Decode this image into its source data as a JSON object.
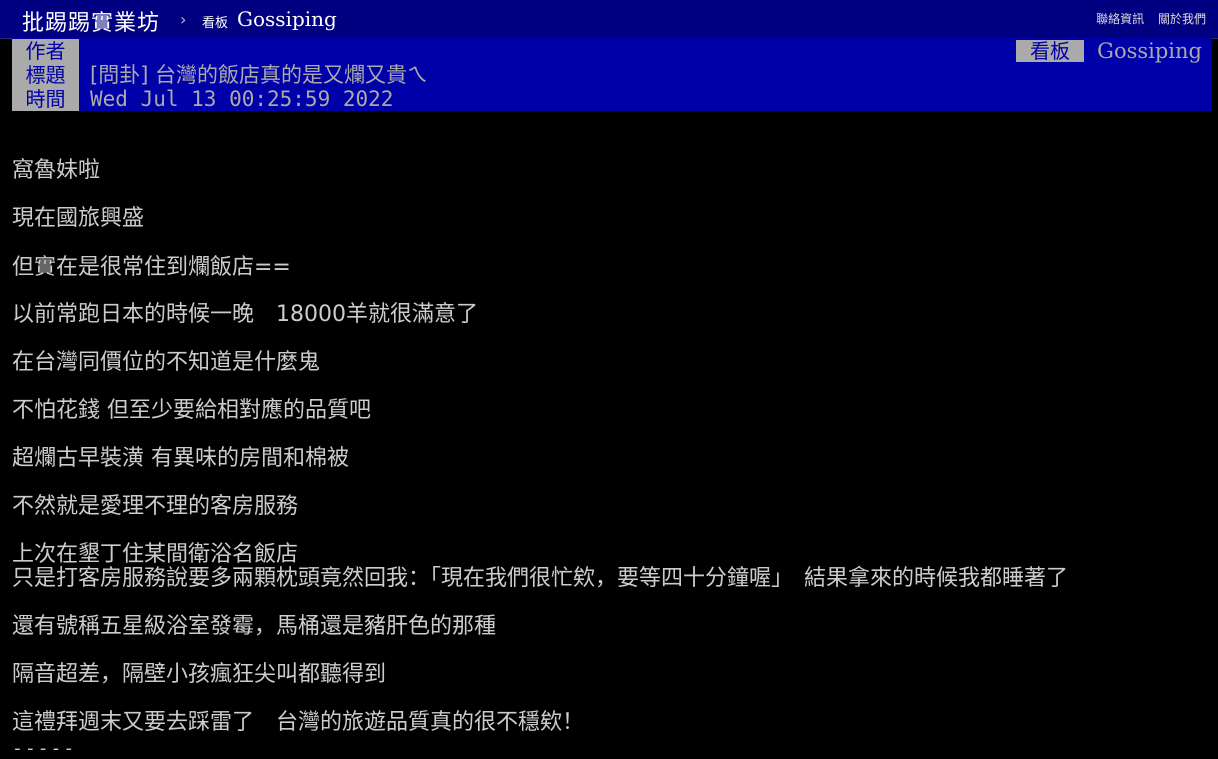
{
  "topbar": {
    "site_name": "批踢踢實業坊",
    "separator": "›",
    "board_prefix": "看板",
    "board_name": "Gossiping",
    "links": [
      "聯絡資訊",
      "關於我們"
    ]
  },
  "meta": {
    "author_label": "作者",
    "author_value": "",
    "title_label": "標題",
    "title_value": "[問卦] 台灣的飯店真的是又爛又貴ㄟ",
    "time_label": "時間",
    "time_value": "Wed Jul 13 00:25:59 2022",
    "board_label": "看板",
    "board_value": "Gossiping"
  },
  "content": {
    "lines": [
      "窩魯妹啦",
      "現在國旅興盛",
      "但實在是很常住到爛飯店==",
      "以前常跑日本的時候一晚　18000羊就很滿意了",
      "在台灣同價位的不知道是什麼鬼",
      "不怕花錢 但至少要給相對應的品質吧",
      "超爛古早裝潢 有異味的房間和棉被",
      "不然就是愛理不理的客房服務",
      "上次在墾丁住某間衛浴名飯店",
      "只是打客房服務說要多兩顆枕頭竟然回我：「現在我們很忙欸，要等四十分鐘喔」　結果拿來的時候我都睡著了",
      "還有號稱五星級浴室發霉，馬桶還是豬肝色的那種",
      "隔音超差，隔壁小孩瘋狂尖叫都聽得到",
      "這禮拜週末又要去踩雷了　台灣的旅遊品質真的很不穩欸！"
    ],
    "separator": "-----"
  }
}
